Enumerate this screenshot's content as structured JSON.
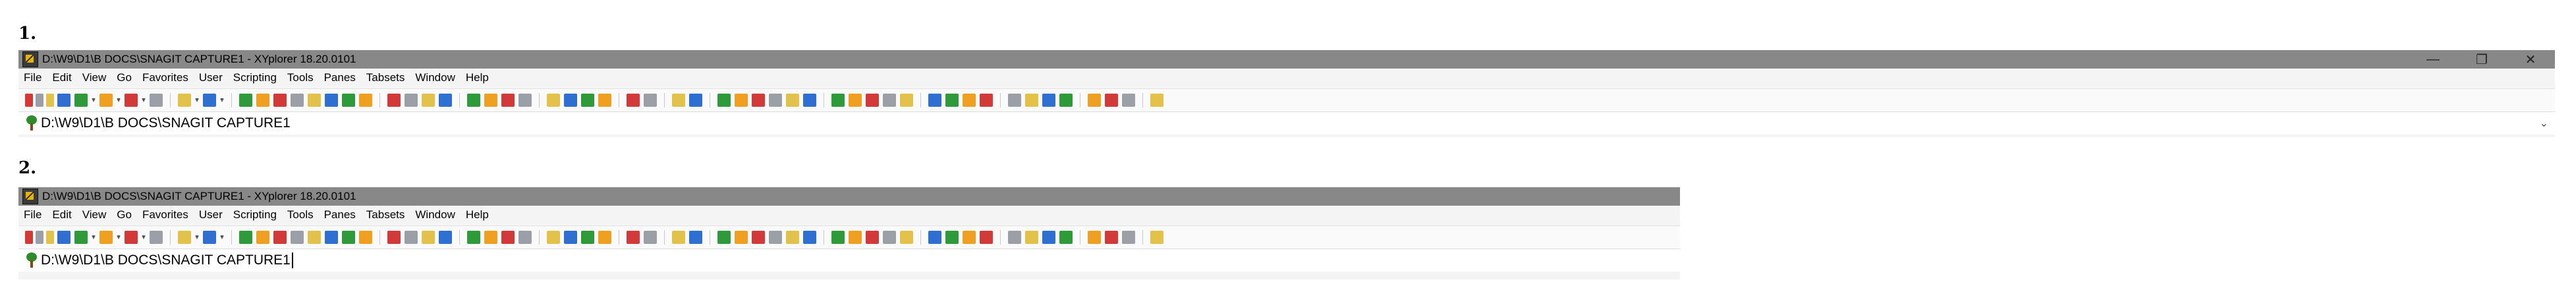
{
  "captures": [
    {
      "number": "1.",
      "title": "D:\\W9\\D1\\B DOCS\\SNAGIT CAPTURE1 - XYplorer 18.20.0101",
      "controls": {
        "minimize": "—",
        "restore": "❐",
        "close": "✕"
      },
      "menu": [
        "File",
        "Edit",
        "View",
        "Go",
        "Favorites",
        "User",
        "Scripting",
        "Tools",
        "Panes",
        "Tabsets",
        "Window",
        "Help"
      ],
      "address": "D:\\W9\\D1\\B DOCS\\SNAGIT CAPTURE1",
      "address_dropdown": "⌄"
    },
    {
      "number": "2.",
      "title": "D:\\W9\\D1\\B DOCS\\SNAGIT CAPTURE1 - XYplorer 18.20.0101",
      "menu": [
        "File",
        "Edit",
        "View",
        "Go",
        "Favorites",
        "User",
        "Scripting",
        "Tools",
        "Panes",
        "Tabsets",
        "Window",
        "Help"
      ],
      "address": "D:\\W9\\D1\\B DOCS\\SNAGIT CAPTURE1"
    }
  ],
  "toolbar_icons": [
    "drive-c",
    "drive-d",
    "drive-h",
    "new-path",
    "back-arrow",
    "forward-arrow",
    "up-arrow",
    "favorite-star",
    "undo",
    "redo",
    "copy-path",
    "refresh",
    "home",
    "target",
    "copy",
    "move",
    "rename",
    "delete",
    "find",
    "highlight",
    "new-folder",
    "new-file",
    "clipboard",
    "tree",
    "list",
    "details",
    "copy-to",
    "move-to",
    "mirror",
    "color-filter",
    "search",
    "zoom",
    "tools",
    "filter",
    "thumbnails",
    "preview",
    "image",
    "audio",
    "save",
    "format",
    "tag",
    "send",
    "pyramid",
    "snapshot",
    "info-a",
    "info-b",
    "info-c",
    "dual-pane",
    "split",
    "pane-list",
    "monitor",
    "config",
    "layout",
    "catalog",
    "tags",
    "help",
    "stop"
  ],
  "toolbar_colors": {
    "blue": "#2f6fd1",
    "green": "#2f9a3a",
    "orange": "#f0a020",
    "red": "#d23a3a",
    "gray": "#9aa0a6",
    "yellow": "#e2c24a"
  }
}
